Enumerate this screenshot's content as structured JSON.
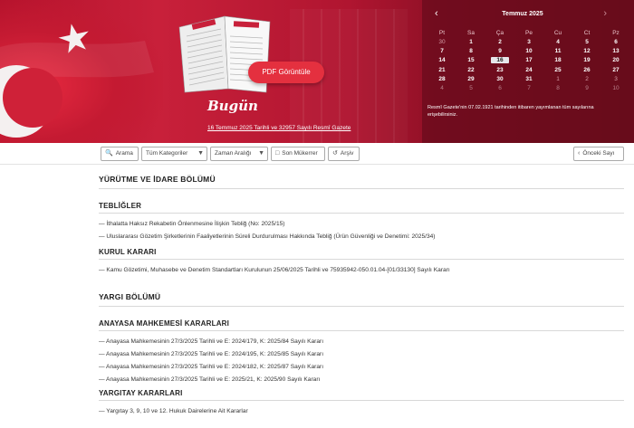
{
  "banner": {
    "pdf_button": "PDF Görüntüle",
    "today_title": "Bugün",
    "today_link": "16 Temmuz 2025 Tarihli ve 32957 Sayılı Resmî Gazete"
  },
  "calendar": {
    "month": "Temmuz 2025",
    "prev": "‹",
    "next": "›",
    "weekdays": [
      "Pt",
      "Sa",
      "Ça",
      "Pe",
      "Cu",
      "Ct",
      "Pz"
    ],
    "weeks": [
      [
        "30",
        "1",
        "2",
        "3",
        "4",
        "5",
        "6"
      ],
      [
        "7",
        "8",
        "9",
        "10",
        "11",
        "12",
        "13"
      ],
      [
        "14",
        "15",
        "16",
        "17",
        "18",
        "19",
        "20"
      ],
      [
        "21",
        "22",
        "23",
        "24",
        "25",
        "26",
        "27"
      ],
      [
        "28",
        "29",
        "30",
        "31",
        "1",
        "2",
        "3"
      ],
      [
        "4",
        "5",
        "6",
        "7",
        "8",
        "9",
        "10"
      ]
    ],
    "selected": "16",
    "note": "Resmî Gazete'nin 07.02.1921 tarihinden itibaren yayımlanan tüm sayılarına erişebilirsiniz."
  },
  "toolbar": {
    "search": "Arama",
    "categories": "Tüm Kategoriler",
    "date_range": "Zaman Aralığı",
    "last_repeat": "Son Mükerrer",
    "archive": "Arşiv",
    "prev_issue": "Önceki Sayı"
  },
  "sections": {
    "yurutme": {
      "title": "YÜRÜTME VE İDARE BÖLÜMÜ",
      "teblig_title": "TEBLİĞLER",
      "teblig": [
        "— İthalatta Haksız Rekabetin Önlenmesine İlişkin Tebliğ (No: 2025/15)",
        "— Uluslararası Gözetim Şirketlerinin Faaliyetlerinin Süreli Durdurulması Hakkında Tebliğ (Ürün Güvenliği ve Denetimi: 2025/34)"
      ],
      "kurul_title": "KURUL KARARI",
      "kurul": [
        "— Kamu Gözetimi, Muhasebe ve Denetim Standartları Kurulunun 25/06/2025 Tarihli ve 75935942-050.01.04-[01/33130] Sayılı Kararı"
      ]
    },
    "yargi": {
      "title": "YARGI BÖLÜMÜ",
      "anayasa_title": "ANAYASA MAHKEMESİ KARARLARI",
      "anayasa": [
        "— Anayasa Mahkemesinin 27/3/2025 Tarihli ve E: 2024/179, K: 2025/84 Sayılı Kararı",
        "— Anayasa Mahkemesinin 27/3/2025 Tarihli ve E: 2024/195, K: 2025/85 Sayılı Kararı",
        "— Anayasa Mahkemesinin 27/3/2025 Tarihli ve E: 2024/182, K: 2025/87 Sayılı Kararı",
        "— Anayasa Mahkemesinin 27/3/2025 Tarihli ve E: 2025/21, K: 2025/90 Sayılı Kararı"
      ],
      "yargitay_title": "YARGITAY KARARLARI",
      "yargitay": [
        "— Yargıtay 3, 9, 10 ve 12. Hukuk Dairelerine Ait Kararlar"
      ]
    }
  },
  "colors": {
    "banner_red": "#b5122c",
    "pdf_button": "#e4303f"
  }
}
